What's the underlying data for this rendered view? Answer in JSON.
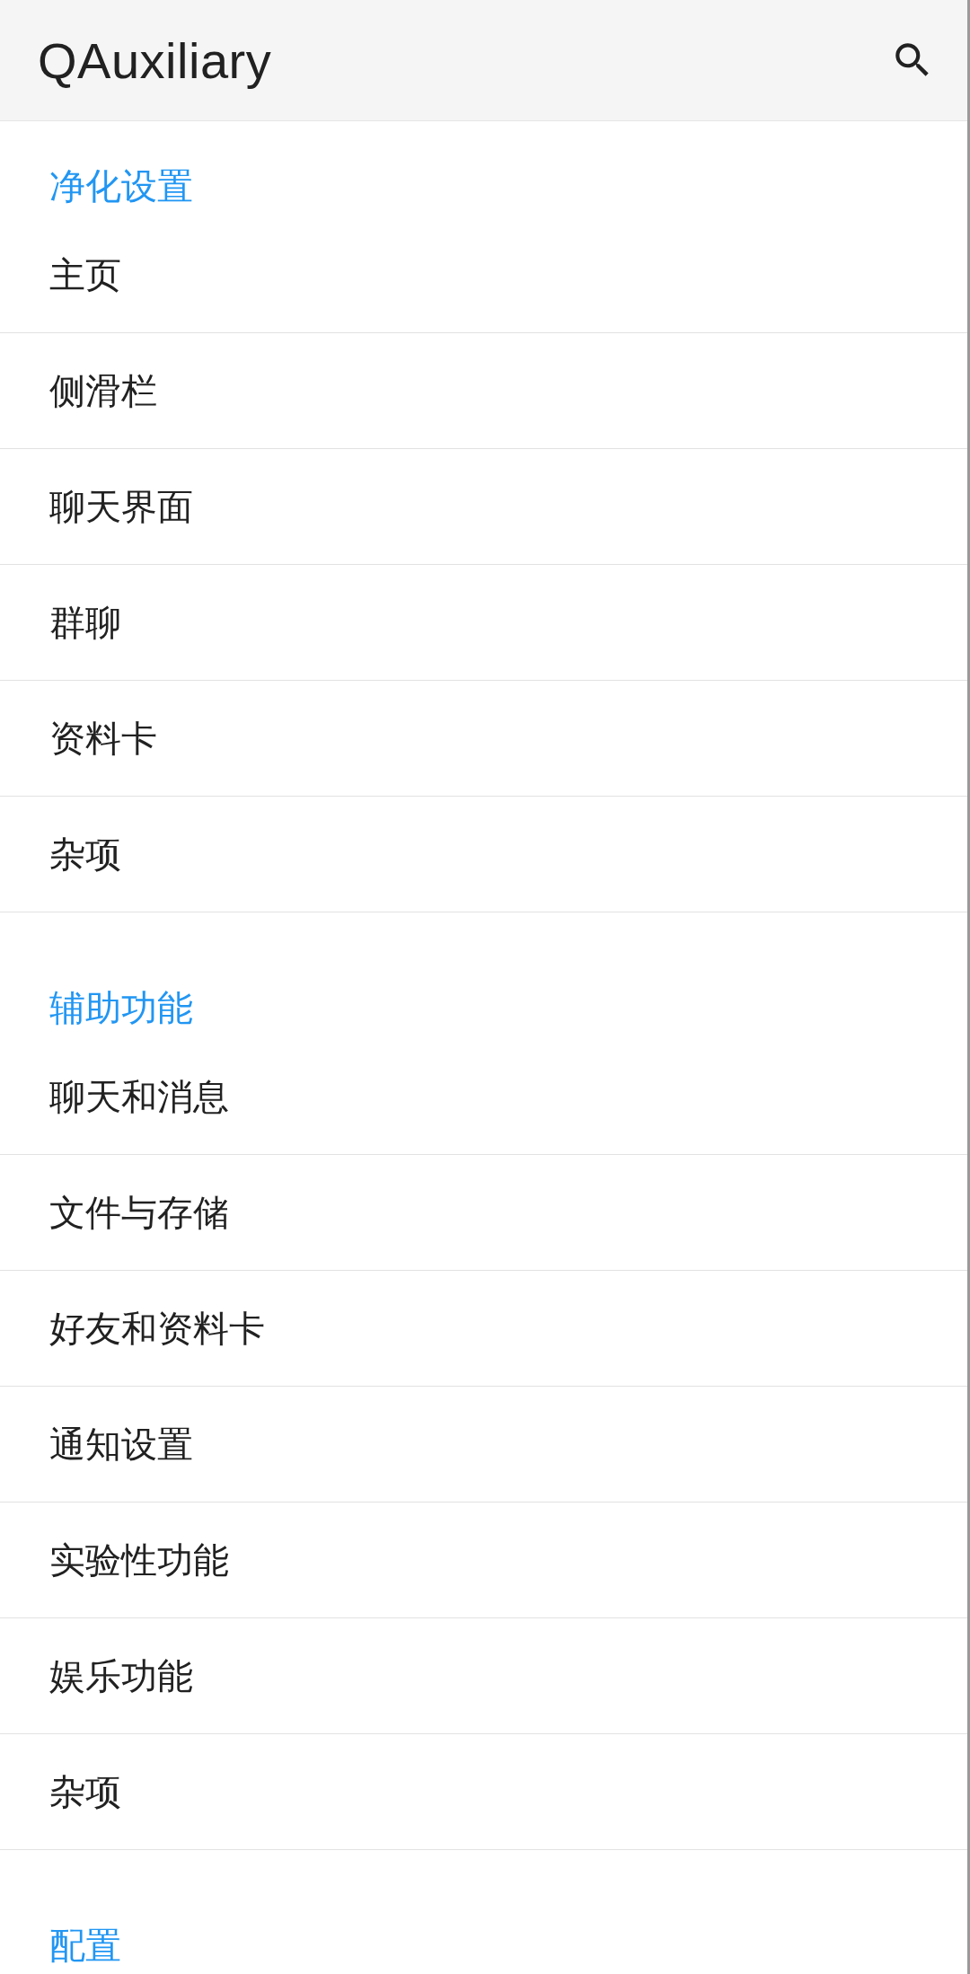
{
  "app_bar": {
    "title": "QAuxiliary"
  },
  "sections": [
    {
      "title": "净化设置",
      "items": [
        {
          "label": "主页"
        },
        {
          "label": "侧滑栏"
        },
        {
          "label": "聊天界面"
        },
        {
          "label": "群聊"
        },
        {
          "label": "资料卡"
        },
        {
          "label": "杂项"
        }
      ]
    },
    {
      "title": "辅助功能",
      "items": [
        {
          "label": "聊天和消息"
        },
        {
          "label": "文件与存储"
        },
        {
          "label": "好友和资料卡"
        },
        {
          "label": "通知设置"
        },
        {
          "label": "实验性功能"
        },
        {
          "label": "娱乐功能"
        },
        {
          "label": "杂项"
        }
      ]
    },
    {
      "title": "配置"
    }
  ]
}
